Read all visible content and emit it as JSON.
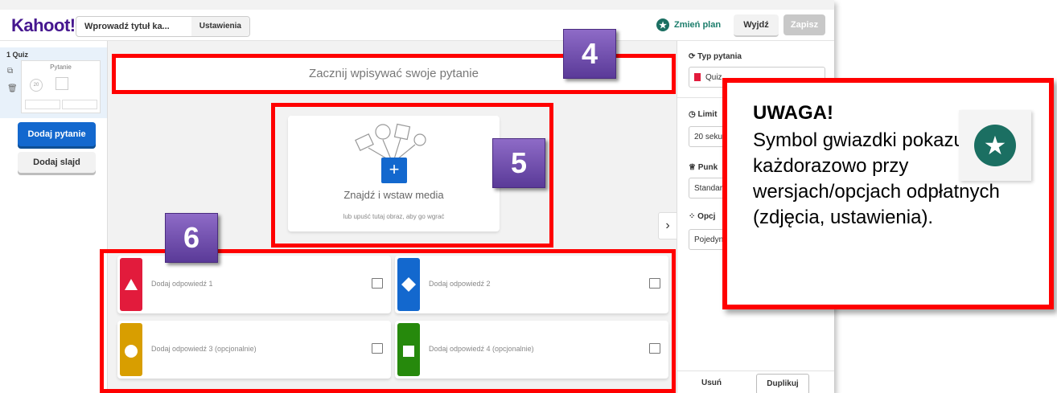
{
  "topbar": {
    "logo": "Kahoot!",
    "title_placeholder": "Wprowadź tytuł ka...",
    "settings": "Ustawienia",
    "upgrade": "Zmień plan",
    "exit": "Wyjdź",
    "save": "Zapisz"
  },
  "sidebar": {
    "slide_label": "1 Quiz",
    "thumb_title": "Pytanie",
    "thumb_timer": "20",
    "add_question": "Dodaj pytanie",
    "add_slide": "Dodaj slajd"
  },
  "main": {
    "question_placeholder": "Zacznij wpisywać swoje pytanie",
    "media_title": "Znajdź i wstaw media",
    "media_subtitle": "lub upuść tutaj obraz, aby go wgrać",
    "answers": [
      {
        "label": "Dodaj odpowiedź 1",
        "color": "#e21b3c",
        "shape": "triangle"
      },
      {
        "label": "Dodaj odpowiedź 2",
        "color": "#1368ce",
        "shape": "diamond"
      },
      {
        "label": "Dodaj odpowiedź 3 (opcjonalnie)",
        "color": "#d89e00",
        "shape": "circle"
      },
      {
        "label": "Dodaj odpowiedź 4 (opcjonalnie)",
        "color": "#26890c",
        "shape": "square"
      }
    ]
  },
  "rightpanel": {
    "question_type_heading": "Typ pytania",
    "question_type_value": "Quiz",
    "time_limit_heading": "Limit",
    "time_limit_value": "20 seku",
    "points_heading": "Punk",
    "points_value": "Standar",
    "options_heading": "Opcj",
    "options_value": "Pojedyn",
    "delete": "Usuń",
    "duplicate": "Duplikuj"
  },
  "annotations": {
    "badge_4": "4",
    "badge_5": "5",
    "badge_6": "6",
    "note_heading": "UWAGA!",
    "note_body": "Symbol gwiazdki pokazuje się każdorazowo przy wersjach/opcjach odpłatnych (zdjęcia, ustawienia)."
  },
  "colors": {
    "brand": "#46178f",
    "primary_blue": "#1368ce",
    "premium_green": "#1b6f62",
    "annotation_red": "#ff0000"
  },
  "icons": [
    "star-icon",
    "image-icon",
    "plus-icon",
    "chevron-right-icon",
    "duplicate-icon",
    "trash-icon",
    "clock-icon",
    "trophy-icon",
    "options-icon",
    "refresh-icon"
  ]
}
